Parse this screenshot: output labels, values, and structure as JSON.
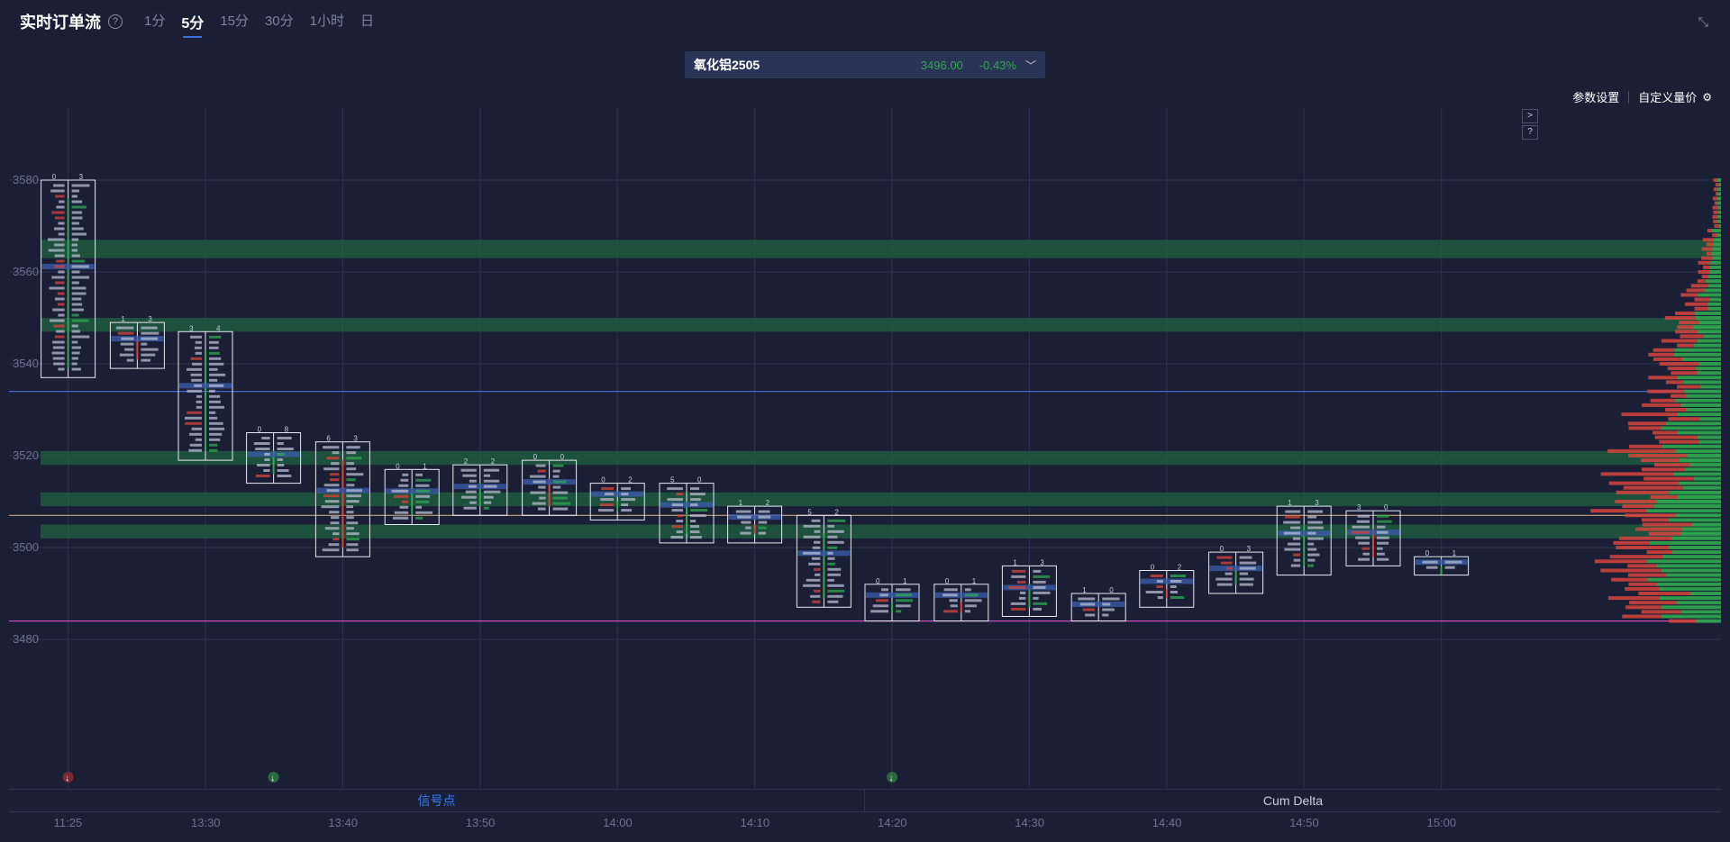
{
  "header": {
    "title": "实时订单流",
    "help_icon": "question-circle-icon",
    "periods": [
      "1分",
      "5分",
      "15分",
      "30分",
      "1小时",
      "日"
    ],
    "active_period": "5分",
    "collapse_icon": "collapse-arrows-icon"
  },
  "instrument": {
    "name": "氧化铝2505",
    "price": "3496.00",
    "change": "-0.43%",
    "chevron_icon": "chevron-down-icon"
  },
  "toolbar": {
    "settings_label": "参数设置",
    "custom_label": "自定义量价",
    "custom_icon": "gear-icon"
  },
  "side_buttons": [
    ">",
    "?"
  ],
  "colors": {
    "background": "#1a1f36",
    "grid": "#2d3452",
    "buy_green": "#2fa84f",
    "sell_red": "#d8443c",
    "poc_blue": "#3a5aa8",
    "hline_orange": "#c9a37a",
    "hline_magenta": "#c64fbd",
    "hline_blue": "#4a66c4"
  },
  "tabs": [
    "信号点",
    "Cum Delta"
  ],
  "chart_data": {
    "type": "footprint",
    "y_ticks": [
      "3580",
      "3560",
      "3540",
      "3520",
      "3500",
      "3480"
    ],
    "x_ticks": [
      "11:25",
      "13:30",
      "13:40",
      "13:50",
      "14:00",
      "14:10",
      "14:20",
      "14:30",
      "14:40",
      "14:50",
      "15:00"
    ],
    "candles": [
      {
        "time": "11:25",
        "high": 3580,
        "low": 3537,
        "top_left": "0",
        "top_right": "3"
      },
      {
        "time": "11:30",
        "high": 3549,
        "low": 3539,
        "top_left": "1",
        "top_right": "3"
      },
      {
        "time": "13:30",
        "high": 3547,
        "low": 3519,
        "top_left": "3",
        "top_right": "4"
      },
      {
        "time": "13:35",
        "high": 3525,
        "low": 3514,
        "top_left": "0",
        "top_right": "8"
      },
      {
        "time": "13:40",
        "high": 3523,
        "low": 3498,
        "top_left": "6",
        "top_right": "3"
      },
      {
        "time": "13:45",
        "high": 3517,
        "low": 3505,
        "top_left": "0",
        "top_right": "1"
      },
      {
        "time": "13:50",
        "high": 3518,
        "low": 3507,
        "top_left": "2",
        "top_right": "2"
      },
      {
        "time": "13:55",
        "high": 3519,
        "low": 3507,
        "top_left": "0",
        "top_right": "0"
      },
      {
        "time": "14:00",
        "high": 3514,
        "low": 3506,
        "top_left": "0",
        "top_right": "2"
      },
      {
        "time": "14:05",
        "high": 3514,
        "low": 3501,
        "top_left": "5",
        "top_right": "0"
      },
      {
        "time": "14:10",
        "high": 3509,
        "low": 3501,
        "top_left": "1",
        "top_right": "2"
      },
      {
        "time": "14:15",
        "high": 3507,
        "low": 3487,
        "top_left": "5",
        "top_right": "2"
      },
      {
        "time": "14:20",
        "high": 3492,
        "low": 3484,
        "top_left": "0",
        "top_right": "1"
      },
      {
        "time": "14:25",
        "high": 3492,
        "low": 3484,
        "top_left": "0",
        "top_right": "1"
      },
      {
        "time": "14:30",
        "high": 3496,
        "low": 3485,
        "top_left": "1",
        "top_right": "3"
      },
      {
        "time": "14:35",
        "high": 3490,
        "low": 3484,
        "top_left": "1",
        "top_right": "0"
      },
      {
        "time": "14:40",
        "high": 3495,
        "low": 3487,
        "top_left": "0",
        "top_right": "2"
      },
      {
        "time": "14:45",
        "high": 3499,
        "low": 3490,
        "top_left": "0",
        "top_right": "3"
      },
      {
        "time": "14:50",
        "high": 3509,
        "low": 3494,
        "top_left": "1",
        "top_right": "3"
      },
      {
        "time": "14:55",
        "high": 3508,
        "low": 3496,
        "top_left": "3",
        "top_right": "0"
      },
      {
        "time": "15:00",
        "high": 3498,
        "low": 3494,
        "top_left": "0",
        "top_right": "1"
      }
    ],
    "horizontal_lines": [
      {
        "price": 3534,
        "color": "blue"
      },
      {
        "price": 3507,
        "color": "orange"
      },
      {
        "price": 3484,
        "color": "magenta"
      }
    ],
    "highlight_zones": [
      {
        "from": 3567,
        "to": 3563
      },
      {
        "from": 3550,
        "to": 3547
      },
      {
        "from": 3521,
        "to": 3518
      },
      {
        "from": 3512,
        "to": 3509
      },
      {
        "from": 3505,
        "to": 3502
      }
    ],
    "signals": [
      {
        "time": "11:25",
        "direction": "down",
        "color": "red"
      },
      {
        "time": "13:35",
        "direction": "down",
        "color": "green"
      },
      {
        "time": "14:20",
        "direction": "down",
        "color": "green"
      }
    ],
    "volume_profile": "right-side buy/sell horizontal histogram"
  }
}
